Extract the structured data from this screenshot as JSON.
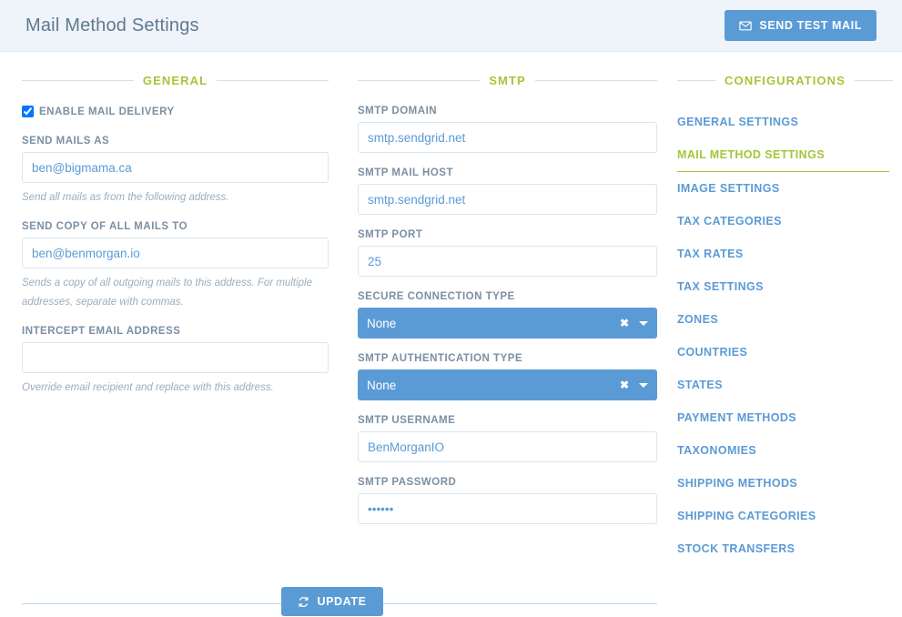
{
  "header": {
    "title": "Mail Method Settings",
    "send_test_mail_label": "SEND TEST MAIL",
    "send_test_mail_icon": "envelope-icon"
  },
  "general": {
    "section_title": "GENERAL",
    "enable_mail_delivery": {
      "label": "ENABLE MAIL DELIVERY",
      "checked": true
    },
    "fields": [
      {
        "label": "SEND MAILS AS",
        "value": "ben@bigmama.ca",
        "placeholder": "",
        "hint": "Send all mails as from the following address."
      },
      {
        "label": "SEND COPY OF ALL MAILS TO",
        "value": "ben@benmorgan.io",
        "placeholder": "",
        "hint": "Sends a copy of all outgoing mails to this address. For multiple addresses, separate with commas."
      },
      {
        "label": "INTERCEPT EMAIL ADDRESS",
        "value": "",
        "placeholder": "",
        "hint": "Override email recipient and replace with this address."
      }
    ]
  },
  "smtp": {
    "section_title": "SMTP",
    "domain": {
      "label": "SMTP DOMAIN",
      "value": "smtp.sendgrid.net",
      "placeholder": ""
    },
    "mail_host": {
      "label": "SMTP MAIL HOST",
      "value": "smtp.sendgrid.net",
      "placeholder": ""
    },
    "port": {
      "label": "SMTP PORT",
      "value": "25",
      "placeholder": ""
    },
    "secure_connection_type": {
      "label": "SECURE CONNECTION TYPE",
      "value": "None",
      "clear_icon": "close-icon",
      "caret_icon": "chevron-down-icon"
    },
    "authentication_type": {
      "label": "SMTP AUTHENTICATION TYPE",
      "value": "None",
      "clear_icon": "close-icon",
      "caret_icon": "chevron-down-icon"
    },
    "username": {
      "label": "SMTP USERNAME",
      "value": "BenMorganIO",
      "placeholder": ""
    },
    "password": {
      "label": "SMTP PASSWORD",
      "value": "••••••",
      "placeholder": ""
    }
  },
  "configurations": {
    "section_title": "CONFIGURATIONS",
    "items": [
      {
        "label": "GENERAL SETTINGS",
        "active": false
      },
      {
        "label": "MAIL METHOD SETTINGS",
        "active": true
      },
      {
        "label": "IMAGE SETTINGS",
        "active": false
      },
      {
        "label": "TAX CATEGORIES",
        "active": false
      },
      {
        "label": "TAX RATES",
        "active": false
      },
      {
        "label": "TAX SETTINGS",
        "active": false
      },
      {
        "label": "ZONES",
        "active": false
      },
      {
        "label": "COUNTRIES",
        "active": false
      },
      {
        "label": "STATES",
        "active": false
      },
      {
        "label": "PAYMENT METHODS",
        "active": false
      },
      {
        "label": "TAXONOMIES",
        "active": false
      },
      {
        "label": "SHIPPING METHODS",
        "active": false
      },
      {
        "label": "SHIPPING CATEGORIES",
        "active": false
      },
      {
        "label": "STOCK TRANSFERS",
        "active": false
      }
    ]
  },
  "footer": {
    "update_label": "UPDATE",
    "update_icon": "refresh-icon"
  },
  "colors": {
    "accent_green": "#a4c63a",
    "accent_blue": "#5b9bd5",
    "header_bg": "#eef4fa",
    "label_gray": "#7b8fa3",
    "hint_gray": "#9badbd",
    "input_border": "#d6e6f3"
  }
}
